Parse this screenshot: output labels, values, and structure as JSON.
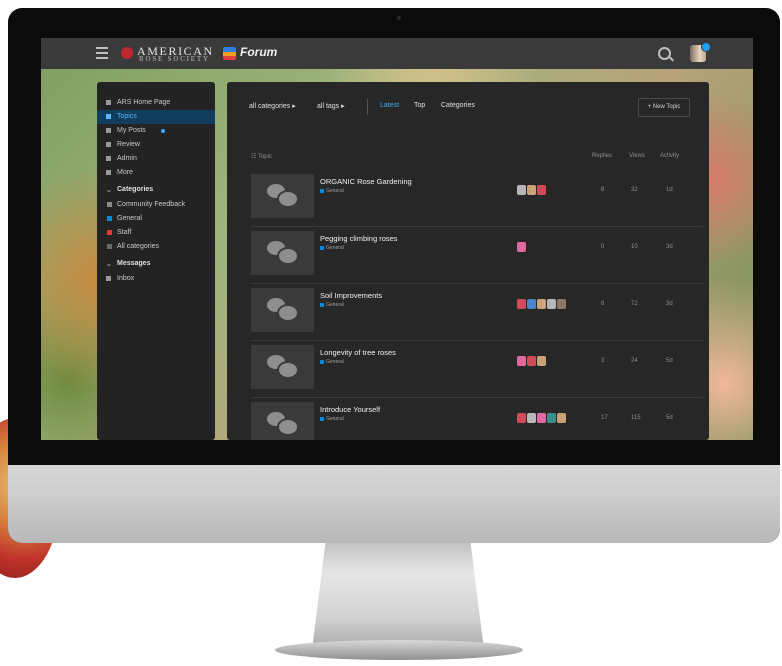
{
  "header": {
    "logo_line1": "AMERICAN",
    "logo_line2": "ROSE SOCIETY",
    "forum_title": "Forum"
  },
  "sidebar": {
    "items": [
      {
        "label": "ARS Home Page",
        "active": false,
        "icon": "link-icon"
      },
      {
        "label": "Topics",
        "active": true,
        "icon": "topics-icon"
      },
      {
        "label": "My Posts",
        "active": false,
        "icon": "user-icon",
        "dot": true
      },
      {
        "label": "Review",
        "active": false,
        "icon": "review-icon"
      },
      {
        "label": "Admin",
        "active": false,
        "icon": "wrench-icon"
      },
      {
        "label": "More",
        "active": false,
        "icon": "more-icon"
      }
    ],
    "categories_heading": "Categories",
    "categories": [
      {
        "label": "Community Feedback",
        "color": "#8a8a8a"
      },
      {
        "label": "General",
        "color": "#0a88d8"
      },
      {
        "label": "Staff",
        "color": "#e03a3a"
      },
      {
        "label": "All categories",
        "color": "#6a6a6a"
      }
    ],
    "messages_heading": "Messages",
    "messages": [
      {
        "label": "Inbox"
      }
    ]
  },
  "nav": {
    "all_categories": "all categories ▸",
    "all_tags": "all tags ▸",
    "latest": "Latest",
    "top": "Top",
    "categories": "Categories",
    "new_topic": "+ New Topic"
  },
  "columns": {
    "topic": "☷ Topic",
    "replies": "Replies",
    "views": "Views",
    "activity": "Activity"
  },
  "topics": [
    {
      "title": "ORGANIC Rose Gardening",
      "category": "General",
      "replies": "8",
      "views": "32",
      "activity": "1d",
      "posters": [
        "#b7b7b7",
        "#c9a27a",
        "#d04a5a"
      ]
    },
    {
      "title": "Pegging climbing roses",
      "category": "General",
      "replies": "0",
      "views": "10",
      "activity": "3d",
      "posters": [
        "#e06aa0"
      ]
    },
    {
      "title": "Soil Improvements",
      "category": "General",
      "replies": "8",
      "views": "72",
      "activity": "3d",
      "posters": [
        "#d04a5a",
        "#4b86c8",
        "#c9a27a",
        "#b7b7b7",
        "#8d7a66"
      ]
    },
    {
      "title": "Longevity of tree roses",
      "category": "General",
      "replies": "3",
      "views": "24",
      "activity": "5d",
      "posters": [
        "#e06aa0",
        "#d04a5a",
        "#c9a27a"
      ]
    },
    {
      "title": "Introduce Yourself",
      "category": "General",
      "replies": "17",
      "views": "115",
      "activity": "5d",
      "posters": [
        "#d04a5a",
        "#b7b7b7",
        "#e06aa0",
        "#3a8f8a",
        "#c9a27a"
      ]
    }
  ]
}
